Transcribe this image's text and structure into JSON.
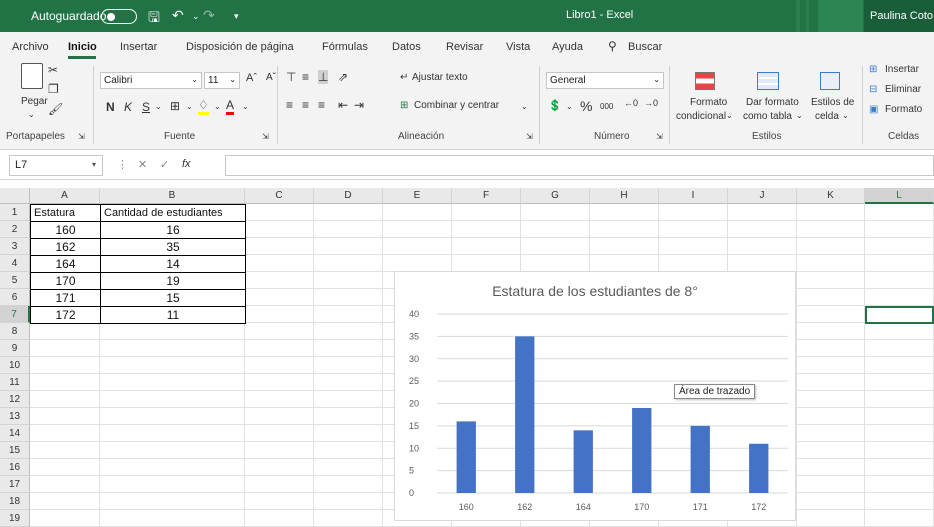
{
  "titlebar": {
    "autosave_label": "Autoguardado",
    "doc_title": "Libro1  -  Excel",
    "user": "Paulina Coto"
  },
  "menu": {
    "tabs": [
      "Archivo",
      "Inicio",
      "Insertar",
      "Disposición de página",
      "Fórmulas",
      "Datos",
      "Revisar",
      "Vista",
      "Ayuda"
    ],
    "search_label": "Buscar"
  },
  "ribbon": {
    "clipboard": {
      "paste": "Pegar",
      "label": "Portapapeles"
    },
    "font": {
      "name": "Calibri",
      "size": "11",
      "label": "Fuente",
      "bold": "N",
      "italic": "K",
      "underline": "S"
    },
    "alignment": {
      "wrap": "Ajustar texto",
      "merge": "Combinar y centrar",
      "label": "Alineación"
    },
    "number": {
      "format": "General",
      "percent": "%",
      "thousands": "000",
      "label": "Número"
    },
    "styles": {
      "conditional_1": "Formato",
      "conditional_2": "condicional",
      "table_1": "Dar formato",
      "table_2": "como tabla",
      "cell_1": "Estilos de",
      "cell_2": "celda",
      "label": "Estilos"
    },
    "cells": {
      "insert": "Insertar",
      "delete": "Eliminar",
      "format": "Formato",
      "label": "Celdas"
    }
  },
  "formula_bar": {
    "name_box": "L7",
    "fx": "fx",
    "value": ""
  },
  "grid": {
    "columns": [
      "A",
      "B",
      "C",
      "D",
      "E",
      "F",
      "G",
      "H",
      "I",
      "J",
      "K",
      "L"
    ],
    "selected_column": "L",
    "selected_row": "7",
    "rows": [
      "1",
      "2",
      "3",
      "4",
      "5",
      "6",
      "7",
      "8",
      "9",
      "10",
      "11",
      "12",
      "13",
      "14",
      "15",
      "16",
      "17",
      "18",
      "19"
    ],
    "table": {
      "headers": [
        "Estatura",
        "Cantidad de estudiantes"
      ],
      "rows": [
        [
          "160",
          "16"
        ],
        [
          "162",
          "35"
        ],
        [
          "164",
          "14"
        ],
        [
          "170",
          "19"
        ],
        [
          "171",
          "15"
        ],
        [
          "172",
          "11"
        ]
      ]
    }
  },
  "chart_data": {
    "type": "bar",
    "title": "Estatura de los estudiantes de 8°",
    "categories": [
      "160",
      "162",
      "164",
      "170",
      "171",
      "172"
    ],
    "values": [
      16,
      35,
      14,
      19,
      15,
      11
    ],
    "ylim": [
      0,
      40
    ],
    "yticks": [
      "0",
      "5",
      "10",
      "15",
      "20",
      "25",
      "30",
      "35",
      "40"
    ],
    "grid": true,
    "legend": "none",
    "bar_color": "#4472C4",
    "tooltip": "Área de trazado"
  },
  "colors": {
    "excel_green": "#217346",
    "bar": "#4472C4"
  }
}
